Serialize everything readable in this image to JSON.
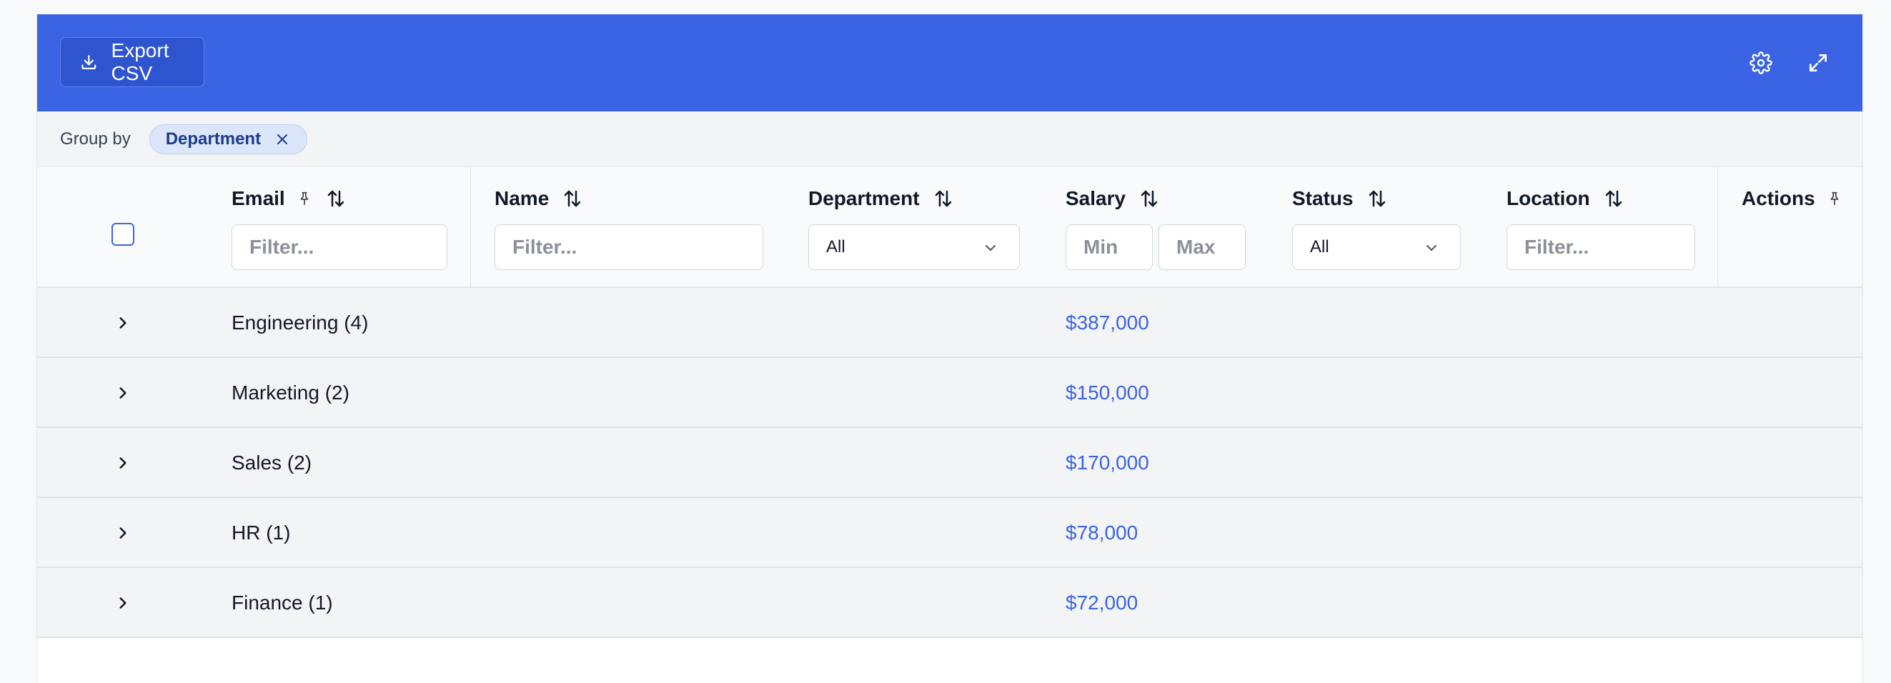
{
  "toolbar": {
    "export_label": "Export CSV"
  },
  "group_by": {
    "label": "Group by",
    "chip": "Department"
  },
  "columns": {
    "email": "Email",
    "name": "Name",
    "department": "Department",
    "salary": "Salary",
    "status": "Status",
    "location": "Location",
    "actions": "Actions"
  },
  "filters": {
    "email_placeholder": "Filter...",
    "name_placeholder": "Filter...",
    "department_value": "All",
    "salary_min_placeholder": "Min",
    "salary_max_placeholder": "Max",
    "status_value": "All",
    "location_placeholder": "Filter..."
  },
  "groups": [
    {
      "label": "Engineering (4)",
      "salary": "$387,000"
    },
    {
      "label": "Marketing (2)",
      "salary": "$150,000"
    },
    {
      "label": "Sales (2)",
      "salary": "$170,000"
    },
    {
      "label": "HR (1)",
      "salary": "$78,000"
    },
    {
      "label": "Finance (1)",
      "salary": "$72,000"
    }
  ],
  "icons": {
    "export": "download-icon",
    "settings": "gear-icon",
    "expand": "expand-icon",
    "remove_chip": "close-icon",
    "sort": "sort-icon",
    "pin": "pin-icon",
    "dropdown": "chevron-down-icon",
    "row_expand": "chevron-right-icon"
  },
  "colors": {
    "toolbar": "#3b64e5",
    "accent": "#3b64e5",
    "row_bg": "#f3f4f6"
  }
}
